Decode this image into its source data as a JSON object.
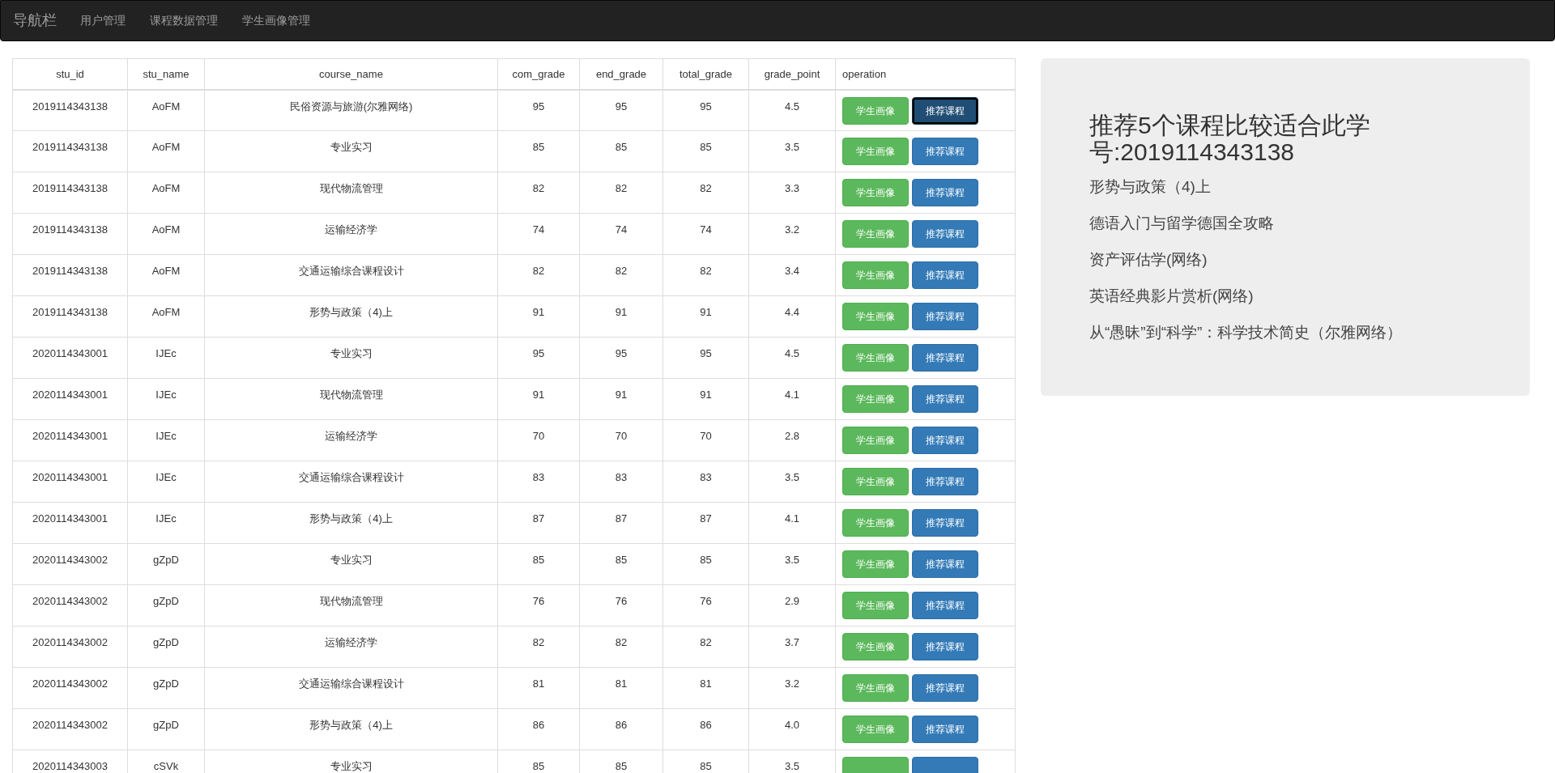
{
  "navbar": {
    "brand": "导航栏",
    "items": [
      "用户管理",
      "课程数据管理",
      "学生画像管理"
    ]
  },
  "table": {
    "columns": [
      "stu_id",
      "stu_name",
      "course_name",
      "com_grade",
      "end_grade",
      "total_grade",
      "grade_point",
      "operation"
    ],
    "rows": [
      {
        "stu_id": "2019114343138",
        "stu_name": "AoFM",
        "course_name": "民俗资源与旅游(尔雅网络)",
        "com_grade": "95",
        "end_grade": "95",
        "total_grade": "95",
        "grade_point": "4.5",
        "profile_button": "学生画像",
        "recommend_button": "推荐课程",
        "recommend_focused": true
      },
      {
        "stu_id": "2019114343138",
        "stu_name": "AoFM",
        "course_name": "专业实习",
        "com_grade": "85",
        "end_grade": "85",
        "total_grade": "85",
        "grade_point": "3.5",
        "profile_button": "学生画像",
        "recommend_button": "推荐课程",
        "recommend_focused": false
      },
      {
        "stu_id": "2019114343138",
        "stu_name": "AoFM",
        "course_name": "现代物流管理",
        "com_grade": "82",
        "end_grade": "82",
        "total_grade": "82",
        "grade_point": "3.3",
        "profile_button": "学生画像",
        "recommend_button": "推荐课程",
        "recommend_focused": false
      },
      {
        "stu_id": "2019114343138",
        "stu_name": "AoFM",
        "course_name": "运输经济学",
        "com_grade": "74",
        "end_grade": "74",
        "total_grade": "74",
        "grade_point": "3.2",
        "profile_button": "学生画像",
        "recommend_button": "推荐课程",
        "recommend_focused": false
      },
      {
        "stu_id": "2019114343138",
        "stu_name": "AoFM",
        "course_name": "交通运输综合课程设计",
        "com_grade": "82",
        "end_grade": "82",
        "total_grade": "82",
        "grade_point": "3.4",
        "profile_button": "学生画像",
        "recommend_button": "推荐课程",
        "recommend_focused": false
      },
      {
        "stu_id": "2019114343138",
        "stu_name": "AoFM",
        "course_name": "形势与政策（4)上",
        "com_grade": "91",
        "end_grade": "91",
        "total_grade": "91",
        "grade_point": "4.4",
        "profile_button": "学生画像",
        "recommend_button": "推荐课程",
        "recommend_focused": false
      },
      {
        "stu_id": "2020114343001",
        "stu_name": "IJEc",
        "course_name": "专业实习",
        "com_grade": "95",
        "end_grade": "95",
        "total_grade": "95",
        "grade_point": "4.5",
        "profile_button": "学生画像",
        "recommend_button": "推荐课程",
        "recommend_focused": false
      },
      {
        "stu_id": "2020114343001",
        "stu_name": "IJEc",
        "course_name": "现代物流管理",
        "com_grade": "91",
        "end_grade": "91",
        "total_grade": "91",
        "grade_point": "4.1",
        "profile_button": "学生画像",
        "recommend_button": "推荐课程",
        "recommend_focused": false
      },
      {
        "stu_id": "2020114343001",
        "stu_name": "IJEc",
        "course_name": "运输经济学",
        "com_grade": "70",
        "end_grade": "70",
        "total_grade": "70",
        "grade_point": "2.8",
        "profile_button": "学生画像",
        "recommend_button": "推荐课程",
        "recommend_focused": false
      },
      {
        "stu_id": "2020114343001",
        "stu_name": "IJEc",
        "course_name": "交通运输综合课程设计",
        "com_grade": "83",
        "end_grade": "83",
        "total_grade": "83",
        "grade_point": "3.5",
        "profile_button": "学生画像",
        "recommend_button": "推荐课程",
        "recommend_focused": false
      },
      {
        "stu_id": "2020114343001",
        "stu_name": "IJEc",
        "course_name": "形势与政策（4)上",
        "com_grade": "87",
        "end_grade": "87",
        "total_grade": "87",
        "grade_point": "4.1",
        "profile_button": "学生画像",
        "recommend_button": "推荐课程",
        "recommend_focused": false
      },
      {
        "stu_id": "2020114343002",
        "stu_name": "gZpD",
        "course_name": "专业实习",
        "com_grade": "85",
        "end_grade": "85",
        "total_grade": "85",
        "grade_point": "3.5",
        "profile_button": "学生画像",
        "recommend_button": "推荐课程",
        "recommend_focused": false
      },
      {
        "stu_id": "2020114343002",
        "stu_name": "gZpD",
        "course_name": "现代物流管理",
        "com_grade": "76",
        "end_grade": "76",
        "total_grade": "76",
        "grade_point": "2.9",
        "profile_button": "学生画像",
        "recommend_button": "推荐课程",
        "recommend_focused": false
      },
      {
        "stu_id": "2020114343002",
        "stu_name": "gZpD",
        "course_name": "运输经济学",
        "com_grade": "82",
        "end_grade": "82",
        "total_grade": "82",
        "grade_point": "3.7",
        "profile_button": "学生画像",
        "recommend_button": "推荐课程",
        "recommend_focused": false
      },
      {
        "stu_id": "2020114343002",
        "stu_name": "gZpD",
        "course_name": "交通运输综合课程设计",
        "com_grade": "81",
        "end_grade": "81",
        "total_grade": "81",
        "grade_point": "3.2",
        "profile_button": "学生画像",
        "recommend_button": "推荐课程",
        "recommend_focused": false
      },
      {
        "stu_id": "2020114343002",
        "stu_name": "gZpD",
        "course_name": "形势与政策（4)上",
        "com_grade": "86",
        "end_grade": "86",
        "total_grade": "86",
        "grade_point": "4.0",
        "profile_button": "学生画像",
        "recommend_button": "推荐课程",
        "recommend_focused": false
      },
      {
        "stu_id": "2020114343003",
        "stu_name": "cSVk",
        "course_name": "专业实习",
        "com_grade": "85",
        "end_grade": "85",
        "total_grade": "85",
        "grade_point": "3.5",
        "recommend_focused": false
      }
    ]
  },
  "recommendation": {
    "title": "推荐5个课程比较适合此学号:2019114343138",
    "courses": [
      "形势与政策（4)上",
      "德语入门与留学德国全攻略",
      "资产评估学(网络)",
      "英语经典影片赏析(网络)",
      "从“愚昧”到“科学”：科学技术简史（尔雅网络）"
    ]
  }
}
